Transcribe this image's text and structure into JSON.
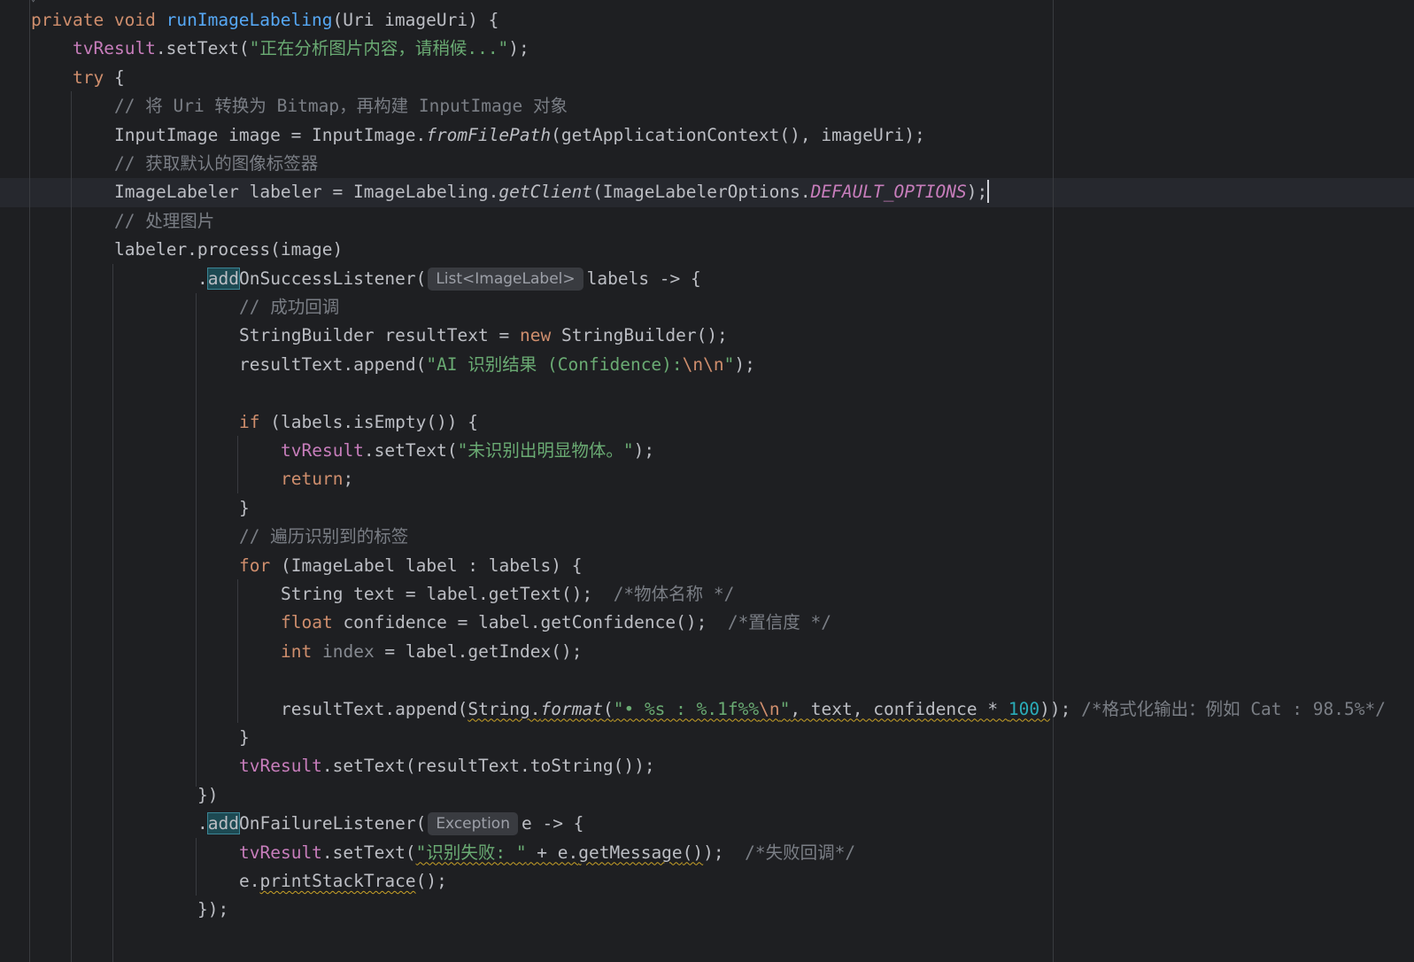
{
  "editor": {
    "lines": [
      {
        "indent": 0,
        "tokens": [
          {
            "t": "private void ",
            "c": "kw"
          },
          {
            "t": "runImageLabeling",
            "c": "fn"
          },
          {
            "t": "(Uri imageUri) {"
          }
        ]
      },
      {
        "indent": 1,
        "tokens": [
          {
            "t": "tvResult",
            "c": "fld"
          },
          {
            "t": ".setText("
          },
          {
            "t": "\"正在分析图片内容，请稍候...\"",
            "c": "str"
          },
          {
            "t": ");"
          }
        ]
      },
      {
        "indent": 1,
        "tokens": [
          {
            "t": "try",
            "c": "kw"
          },
          {
            "t": " {"
          }
        ]
      },
      {
        "indent": 2,
        "tokens": [
          {
            "t": "// 将 Uri 转换为 Bitmap，再构建 InputImage 对象",
            "c": "cmt"
          }
        ]
      },
      {
        "indent": 2,
        "tokens": [
          {
            "t": "InputImage image = InputImage."
          },
          {
            "t": "fromFilePath",
            "c": "ital"
          },
          {
            "t": "(getApplicationContext(), imageUri);"
          }
        ]
      },
      {
        "indent": 2,
        "tokens": [
          {
            "t": "// 获取默认的图像标签器",
            "c": "cmt"
          }
        ]
      },
      {
        "indent": 2,
        "current": true,
        "tokens": [
          {
            "t": "ImageLabeler labeler = ImageLabeling."
          },
          {
            "t": "getClient",
            "c": "ital"
          },
          {
            "t": "(ImageLabelerOptions."
          },
          {
            "t": "DEFAULT_OPTIONS",
            "c": "fld ital"
          },
          {
            "t": ");"
          },
          {
            "caret": true
          }
        ]
      },
      {
        "indent": 2,
        "tokens": [
          {
            "t": "// 处理图片",
            "c": "cmt"
          }
        ]
      },
      {
        "indent": 2,
        "tokens": [
          {
            "t": "labeler.process(image)"
          }
        ]
      },
      {
        "indent": 4,
        "tokens": [
          {
            "t": "."
          },
          {
            "t": "add",
            "c": "match"
          },
          {
            "t": "OnSuccessListener("
          },
          {
            "hint": "List<ImageLabel>"
          },
          {
            "t": "labels -> {"
          }
        ]
      },
      {
        "indent": 5,
        "tokens": [
          {
            "t": "// 成功回调",
            "c": "cmt"
          }
        ]
      },
      {
        "indent": 5,
        "tokens": [
          {
            "t": "StringBuilder resultText = "
          },
          {
            "t": "new",
            "c": "kw"
          },
          {
            "t": " StringBuilder();"
          }
        ]
      },
      {
        "indent": 5,
        "tokens": [
          {
            "t": "resultText.append("
          },
          {
            "t": "\"AI 识别结果 (Confidence):",
            "c": "str"
          },
          {
            "t": "\\n\\n",
            "c": "esc"
          },
          {
            "t": "\"",
            "c": "str"
          },
          {
            "t": ");"
          }
        ]
      },
      {
        "indent": 5,
        "tokens": []
      },
      {
        "indent": 5,
        "tokens": [
          {
            "t": "if",
            "c": "kw"
          },
          {
            "t": " (labels.isEmpty()) {"
          }
        ]
      },
      {
        "indent": 6,
        "tokens": [
          {
            "t": "tvResult",
            "c": "fld"
          },
          {
            "t": ".setText("
          },
          {
            "t": "\"未识别出明显物体。\"",
            "c": "str"
          },
          {
            "t": ");"
          }
        ]
      },
      {
        "indent": 6,
        "tokens": [
          {
            "t": "return",
            "c": "kw"
          },
          {
            "t": ";"
          }
        ]
      },
      {
        "indent": 5,
        "tokens": [
          {
            "t": "}"
          }
        ]
      },
      {
        "indent": 5,
        "tokens": [
          {
            "t": "// 遍历识别到的标签",
            "c": "cmt"
          }
        ]
      },
      {
        "indent": 5,
        "tokens": [
          {
            "t": "for",
            "c": "kw"
          },
          {
            "t": " (ImageLabel label : labels) {"
          }
        ]
      },
      {
        "indent": 6,
        "tokens": [
          {
            "t": "String text = label.getText();  "
          },
          {
            "t": "/*物体名称 */",
            "c": "cmt"
          }
        ]
      },
      {
        "indent": 6,
        "tokens": [
          {
            "t": "float",
            "c": "kw"
          },
          {
            "t": " confidence = label.getConfidence();  "
          },
          {
            "t": "/*置信度 */",
            "c": "cmt"
          }
        ]
      },
      {
        "indent": 6,
        "tokens": [
          {
            "t": "int",
            "c": "kw"
          },
          {
            "t": " "
          },
          {
            "t": "index",
            "c": "unused"
          },
          {
            "t": " = label.getIndex();"
          }
        ]
      },
      {
        "indent": 6,
        "tokens": []
      },
      {
        "indent": 6,
        "tokens": [
          {
            "t": "resultText.append("
          },
          {
            "t": "String.",
            "c": "warn"
          },
          {
            "t": "format",
            "c": "ital warn"
          },
          {
            "t": "(",
            "c": "warn"
          },
          {
            "t": "\"• %s : %.1f%%",
            "c": "str warn"
          },
          {
            "t": "\\n",
            "c": "esc warn"
          },
          {
            "t": "\"",
            "c": "str warn"
          },
          {
            "t": ", text, confidence * ",
            "c": "warn"
          },
          {
            "t": "100",
            "c": "num warn"
          },
          {
            "t": ")",
            "c": "warn"
          },
          {
            "t": "); "
          },
          {
            "t": "/*格式化输出：例如 Cat : 98.5%*/",
            "c": "cmt"
          }
        ]
      },
      {
        "indent": 5,
        "tokens": [
          {
            "t": "}"
          }
        ]
      },
      {
        "indent": 5,
        "tokens": [
          {
            "t": "tvResult",
            "c": "fld"
          },
          {
            "t": ".setText(resultText.toString());"
          }
        ]
      },
      {
        "indent": 4,
        "tokens": [
          {
            "t": "})"
          }
        ]
      },
      {
        "indent": 4,
        "tokens": [
          {
            "t": "."
          },
          {
            "t": "add",
            "c": "match"
          },
          {
            "t": "OnFailureListener("
          },
          {
            "hint": "Exception"
          },
          {
            "t": "e -> {"
          }
        ]
      },
      {
        "indent": 5,
        "tokens": [
          {
            "t": "tvResult",
            "c": "fld"
          },
          {
            "t": ".setText("
          },
          {
            "t": "\"识别失败: \"",
            "c": "str warn"
          },
          {
            "t": " + e.",
            "c": "warn"
          },
          {
            "t": "getMessage",
            "c": "warn"
          },
          {
            "t": "()",
            "c": "warn"
          },
          {
            "t": ");  "
          },
          {
            "t": "/*失败回调*/",
            "c": "cmt"
          }
        ]
      },
      {
        "indent": 5,
        "tokens": [
          {
            "t": "e."
          },
          {
            "t": "printStackTrace",
            "c": "warn"
          },
          {
            "t": "();"
          }
        ]
      },
      {
        "indent": 4,
        "tokens": [
          {
            "t": "});"
          }
        ]
      }
    ]
  }
}
